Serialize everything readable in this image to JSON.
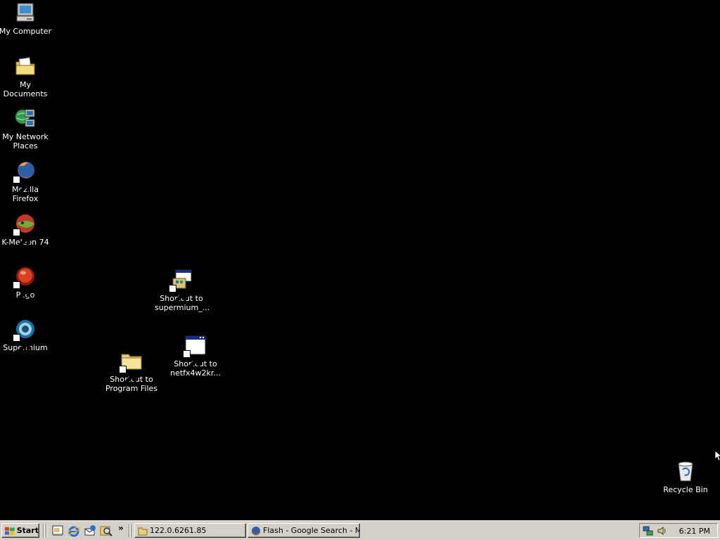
{
  "desktop": {
    "icons": [
      {
        "label": "My Computer",
        "icon": "my-computer-icon"
      },
      {
        "label": "My Documents",
        "icon": "my-documents-icon"
      },
      {
        "label": "My Network Places",
        "icon": "my-network-places-icon"
      },
      {
        "label": "Mozilla Firefox",
        "icon": "firefox-icon"
      },
      {
        "label": "K-Meleon 74",
        "icon": "k-meleon-icon"
      },
      {
        "label": "Pego",
        "icon": "pego-icon"
      },
      {
        "label": "Supermium",
        "icon": "supermium-icon"
      },
      {
        "label": "Shortcut to supermium_...",
        "icon": "installer-icon"
      },
      {
        "label": "Shortcut to netfx4w2kr...",
        "icon": "application-window-icon"
      },
      {
        "label": "Shortcut to Program Files",
        "icon": "folder-icon"
      },
      {
        "label": "Recycle Bin",
        "icon": "recycle-bin-icon"
      }
    ]
  },
  "taskbar": {
    "start_label": "Start",
    "quick_launch": [
      "show-desktop-icon",
      "internet-explorer-icon",
      "outlook-express-icon",
      "search-icon"
    ],
    "quick_launch_more": "»",
    "tasks": [
      {
        "label": "122.0.6261.85",
        "icon": "folder-icon"
      },
      {
        "label": "Flash - Google Search - M...",
        "icon": "firefox-icon"
      }
    ],
    "tray_icons": [
      "network-icon",
      "volume-icon"
    ],
    "clock": "6:21 PM"
  },
  "colors": {
    "desktop_background": "#000000",
    "taskbar_background": "#d4d0c8"
  }
}
